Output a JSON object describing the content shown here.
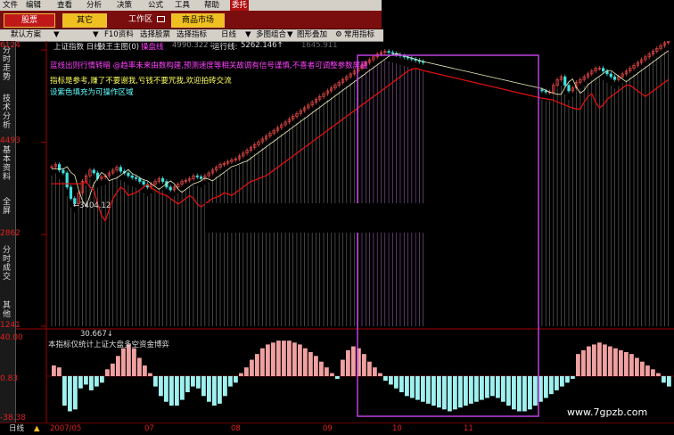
{
  "menu": [
    "文件",
    "编辑",
    "查看",
    "分析",
    "决策",
    "公式",
    "工具",
    "帮助",
    "委托"
  ],
  "toolbar_top": {
    "stock_btn": "股票",
    "other_btn": "其它",
    "workspace": "工作区",
    "market_btn": "商品市场"
  },
  "toolbar": {
    "default_scheme": "默认方案",
    "f10": "F10资料",
    "select_stock": "选择股票",
    "select_indicator": "选择指标",
    "daily": "日线",
    "multi_chart": "多图组合",
    "overlay": "图形叠加",
    "common_indicator": "常用指标"
  },
  "side_tabs": [
    "分时走势",
    "技术分析",
    "基本资料",
    "全屏",
    "分时成交",
    "其他"
  ],
  "chart_header": {
    "title": "上证指数 日线",
    "main_indicator": "鼓王主图(0)",
    "line1_label": "操盘线",
    "line1_value": "4990.322↓",
    "line2_label": "运行线:",
    "line2_value": "5262.146↑",
    "value3": "1645.911"
  },
  "annotations": [
    "蓝线出则行情转暗 @趋率未来由数构建,预测速度等相关故调有信号谨慎,不喜者可调整参数屏蔽",
    "指标是参考,赚了不要谢我,亏钱不要咒我,欢迎拍砖交流",
    "设紫色填充为可操作区域"
  ],
  "low_marker": "←3404.12",
  "y_axis": [
    "6124",
    "4493",
    "2862",
    "1241"
  ],
  "sub_header": "30.667↓",
  "sub_caption": "本指标仅统计上证大盘多空资金博弈",
  "sub_y_axis": [
    "40.00",
    "0.83",
    "-38.38"
  ],
  "bottom": {
    "label": "日线",
    "dates": [
      "2007/05",
      "07",
      "08",
      "09",
      "10",
      "11"
    ]
  },
  "watermark": "www.7gpzb.com",
  "colors": {
    "up": "#ff5050",
    "down": "#40e0e0",
    "bar_pos": "#f0a0a0",
    "bar_neg": "#a0f0f0",
    "line_red": "#e01010",
    "line_white": "#f0f0c0",
    "purple": "#c040e0",
    "ann_magenta": "#ff40ff",
    "ann_yellow": "#ffff60",
    "ann_cyan": "#60ffff"
  },
  "chart_data": [
    {
      "type": "candlestick",
      "title": "上证指数 日线",
      "ylim": [
        1241,
        6124
      ],
      "y_ticks": [
        6124,
        4493,
        2862,
        1241
      ],
      "x_ticks": [
        "2007/05",
        "07",
        "08",
        "09",
        "10",
        "11"
      ],
      "close": [
        4060,
        4100,
        4000,
        3950,
        3700,
        3500,
        3404,
        3600,
        3800,
        3900,
        4000,
        3950,
        3850,
        3880,
        3900,
        3950,
        4000,
        4050,
        3980,
        3950,
        3900,
        3870,
        3850,
        3800,
        3750,
        3700,
        3750,
        3800,
        3850,
        3800,
        3700,
        3650,
        3700,
        3750,
        3800,
        3820,
        3850,
        3900,
        3880,
        3850,
        3900,
        3950,
        4000,
        4050,
        4100,
        4120,
        4150,
        4180,
        4200,
        4250,
        4300,
        4350,
        4400,
        4450,
        4500,
        4550,
        4600,
        4650,
        4700,
        4750,
        4800,
        4850,
        4900,
        4950,
        5000,
        5050,
        5100,
        5150,
        5200,
        5250,
        5300,
        5350,
        5400,
        5450,
        5500,
        5550,
        5600,
        5650,
        5700,
        5750,
        5800,
        5850,
        5900,
        5950,
        6000,
        6050,
        6080,
        6100,
        6080,
        6060,
        6040,
        6020,
        6000,
        5980,
        5960,
        5940,
        5920,
        5900,
        5880,
        5860,
        5840,
        5820,
        5800,
        5780,
        5760,
        5740,
        5720,
        5700,
        5690,
        5680,
        5670,
        5660,
        5650,
        5640,
        5630,
        5620,
        5610,
        5600,
        5590,
        5580,
        5570,
        5560,
        5550,
        5540,
        5500,
        5480,
        5450,
        5420,
        5400,
        5380,
        5380,
        5500,
        5600,
        5650,
        5500,
        5400,
        5450,
        5550,
        5600,
        5650,
        5700,
        5750,
        5800,
        5800,
        5750,
        5700,
        5650,
        5600,
        5650,
        5700,
        5750,
        5800,
        5850,
        5900,
        5950,
        6000,
        6050,
        6100,
        6150,
        6200,
        6250,
        6280
      ]
    },
    {
      "type": "bar",
      "title": "本指标仅统计上证大盘多空资金博弈",
      "ylim": [
        -38.38,
        40.0
      ],
      "values": [
        12,
        10,
        -30,
        -36,
        -34,
        -12,
        -8,
        -14,
        -10,
        -6,
        8,
        14,
        22,
        30,
        34,
        30,
        20,
        12,
        4,
        -10,
        -20,
        -26,
        -30,
        -30,
        -24,
        -16,
        -10,
        -12,
        -20,
        -26,
        -30,
        -28,
        -20,
        -10,
        -6,
        4,
        10,
        18,
        24,
        30,
        34,
        36,
        38,
        38,
        38,
        36,
        34,
        30,
        26,
        22,
        16,
        10,
        4,
        -2,
        18,
        28,
        32,
        30,
        24,
        16,
        10,
        4,
        -4,
        -8,
        -12,
        -16,
        -20,
        -22,
        -24,
        -26,
        -28,
        -30,
        -32,
        -34,
        -36,
        -34,
        -32,
        -30,
        -28,
        -26,
        -24,
        -22,
        -20,
        -22,
        -26,
        -30,
        -34,
        -36,
        -36,
        -34,
        -30,
        -26,
        -22,
        -18,
        -14,
        -10,
        -6,
        -2,
        24,
        28,
        32,
        34,
        36,
        34,
        32,
        30,
        28,
        26,
        24,
        20,
        16,
        12,
        8,
        4,
        -6,
        -10
      ]
    }
  ]
}
